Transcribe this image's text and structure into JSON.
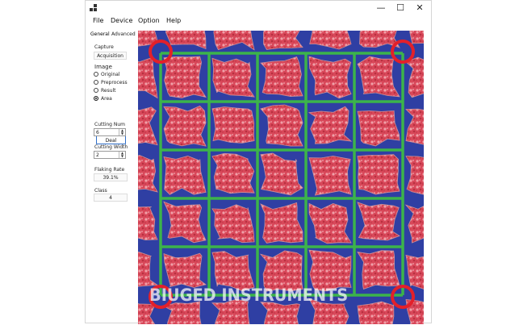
{
  "window": {
    "controls": {
      "minimize": "—",
      "maximize": "☐",
      "close": "✕"
    }
  },
  "menu": {
    "items": [
      "File",
      "Device",
      "Option",
      "Help"
    ]
  },
  "tabs": {
    "general": "General",
    "advanced": "Advanced"
  },
  "capture": {
    "label": "Capture",
    "value": "Acquisition"
  },
  "image_group": {
    "label": "Image",
    "options": [
      "Original",
      "Preprocess",
      "Result",
      "Area"
    ],
    "selected": "Area"
  },
  "deal_button": "Deal",
  "cutting_num": {
    "label": "Cutting Num",
    "value": "6"
  },
  "cutting_width": {
    "label": "Cutting Width",
    "value": "2"
  },
  "flaking_rate": {
    "label": "Flaking Rate",
    "value": "39.1%"
  },
  "class": {
    "label": "Class",
    "value": "4"
  },
  "watermark": "BIUGED INSTRUMENTS",
  "colors": {
    "background_blue": "#2f3fa3",
    "sample_red": "#d9485a",
    "grid_green": "#3cb44b",
    "marker_red": "#e3202a"
  }
}
